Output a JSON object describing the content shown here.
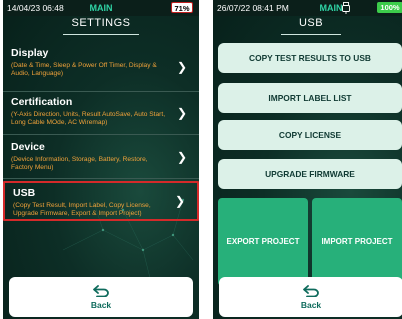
{
  "left": {
    "status": {
      "time": "14/04/23 06:48",
      "mode": "MAIN",
      "battery": "71%"
    },
    "title": "SETTINGS",
    "items": [
      {
        "label": "Display",
        "desc": "(Date & Time, Sleep & Power Off Timer, Display & Audio, Language)"
      },
      {
        "label": "Certification",
        "desc": "(Y-Axis Direction, Units, Result AutoSave, Auto Start, Long Cable MOde, AC Wiremap)"
      },
      {
        "label": "Device",
        "desc": "(Device Information, Storage, Battery, Restore, Factory Menu)"
      },
      {
        "label": "USB",
        "desc": "(Copy Test Result, Import Label, Copy License, Upgrade Firmware, Export & Import Project)"
      }
    ],
    "back_label": "Back"
  },
  "right": {
    "status": {
      "time": "26/07/22 08:41 PM",
      "mode": "MAIN",
      "battery": "100%"
    },
    "title": "USB",
    "buttons": [
      "COPY TEST RESULTS TO USB",
      "IMPORT LABEL LIST",
      "COPY LICENSE",
      "UPGRADE FIRMWARE"
    ],
    "export_label": "EXPORT PROJECT",
    "import_label": "IMPORT PROJECT",
    "back_label": "Back"
  },
  "icons": {
    "chevron": "chevron-right-icon",
    "back": "back-arrow-icon",
    "usb": "usb-icon"
  },
  "colors": {
    "accent": "#2fd3a5",
    "desc_text": "#f0a23a",
    "selection": "#d42a2a",
    "big_button": "#27b07a",
    "button_bg": "#dcf1e8"
  }
}
